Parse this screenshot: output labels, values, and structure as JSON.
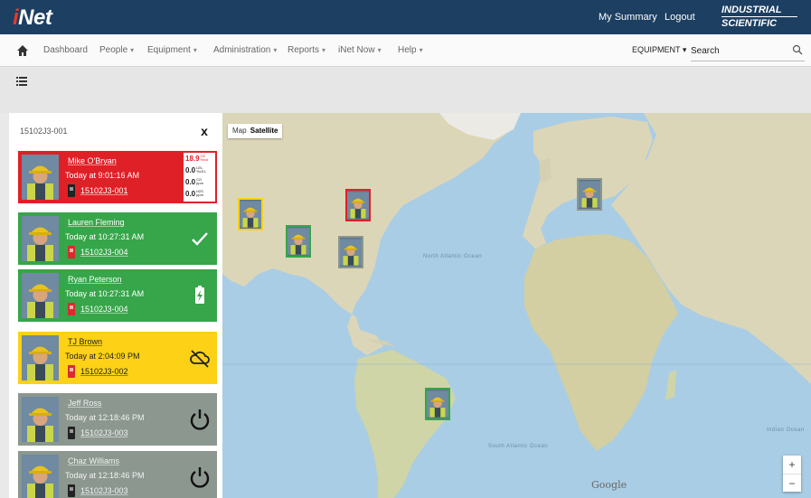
{
  "header": {
    "logo": "iNet",
    "my_summary": "My Summary",
    "logout": "Logout",
    "brand_line1": "INDUSTRIAL",
    "brand_line2": "SCIENTIFIC"
  },
  "nav": {
    "items": [
      {
        "label": "Dashboard",
        "has_menu": false
      },
      {
        "label": "People",
        "has_menu": true
      },
      {
        "label": "Equipment",
        "has_menu": true
      },
      {
        "label": "Administration",
        "has_menu": true
      },
      {
        "label": "Reports",
        "has_menu": true
      },
      {
        "label": "iNet Now",
        "has_menu": true
      },
      {
        "label": "Help",
        "has_menu": true
      }
    ],
    "equipment_dropdown": "EQUIPMENT ▾",
    "search_placeholder": "Search"
  },
  "panel": {
    "title": "15102J3-001",
    "close": "x"
  },
  "cards": [
    {
      "status": "red",
      "name": "Mike O'Bryan",
      "time": "Today at 9:01:16 AM",
      "device": "15102J3-001",
      "readings": [
        {
          "value": "18.9",
          "unit": "O2 %vol",
          "alarm": true
        },
        {
          "value": "0.0",
          "unit": "LEL %LEL",
          "alarm": false
        },
        {
          "value": "0.0",
          "unit": "CO ppm",
          "alarm": false
        },
        {
          "value": "0.0",
          "unit": "H2S ppm",
          "alarm": false
        }
      ]
    },
    {
      "status": "green",
      "name": "Lauren Fleming",
      "time": "Today at 10:27:31 AM",
      "device": "15102J3-004",
      "icon": "check-icon"
    },
    {
      "status": "green",
      "name": "Ryan Peterson",
      "time": "Today at 10:27:31 AM",
      "device": "15102J3-004",
      "icon": "battery-charging-icon"
    },
    {
      "status": "yellow",
      "name": "TJ Brown",
      "time": "Today at 2:04:09 PM",
      "device": "15102J3-002",
      "icon": "cloud-off-icon"
    },
    {
      "status": "gray",
      "name": "Jeff Ross",
      "time": "Today at 12:18:46 PM",
      "device": "15102J3-003",
      "icon": "power-icon"
    },
    {
      "status": "gray",
      "name": "Chaz Williams",
      "time": "Today at 12:18:46 PM",
      "device": "15102J3-003",
      "icon": "power-icon"
    }
  ],
  "map": {
    "type_label": "Map",
    "type_selected": "Satellite",
    "zoom_in": "+",
    "zoom_out": "−",
    "attribution": "Google",
    "north_atlantic": "North Atlantic Ocean",
    "south_atlantic": "South Atlantic Ocean",
    "indian": "Indian Ocean",
    "markers": [
      {
        "status": "yellow",
        "label": "TJ Brown"
      },
      {
        "status": "green",
        "label": "Lauren Fleming"
      },
      {
        "status": "red",
        "label": "Mike O'Bryan"
      },
      {
        "status": "gray",
        "label": "Jeff Ross"
      },
      {
        "status": "gray",
        "label": "Chaz Williams"
      },
      {
        "status": "green",
        "label": "Ryan Peterson"
      }
    ]
  },
  "colors": {
    "header_bg": "#1c3f62",
    "alarm_red": "#e02027",
    "ok_green": "#37a54a",
    "warn_yellow": "#fcd116",
    "offline_gray": "#8b978f"
  }
}
